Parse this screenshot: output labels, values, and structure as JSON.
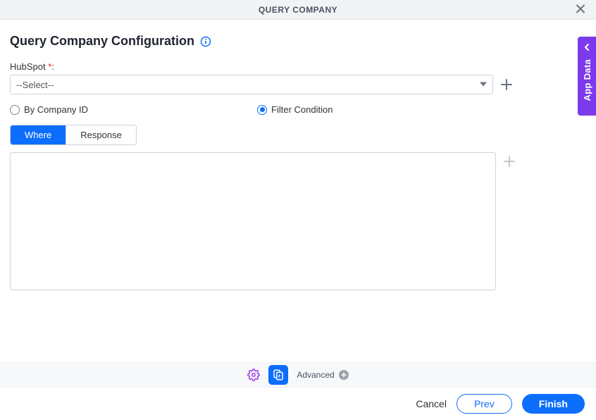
{
  "header": {
    "title": "QUERY COMPANY"
  },
  "page": {
    "title": "Query Company Configuration"
  },
  "fields": {
    "hubspot": {
      "label": "HubSpot",
      "required_mark": "*",
      "selected": "--Select--"
    }
  },
  "radios": {
    "by_company_id": "By Company ID",
    "filter_condition": "Filter Condition",
    "selected": "filter_condition"
  },
  "tabs": {
    "where": "Where",
    "response": "Response",
    "active": "where"
  },
  "sidepanel": {
    "label": "App Data"
  },
  "toolbar": {
    "advanced": "Advanced"
  },
  "footer": {
    "cancel": "Cancel",
    "prev": "Prev",
    "finish": "Finish"
  },
  "colors": {
    "primary": "#0d6efd",
    "purple": "#7c3aed"
  }
}
